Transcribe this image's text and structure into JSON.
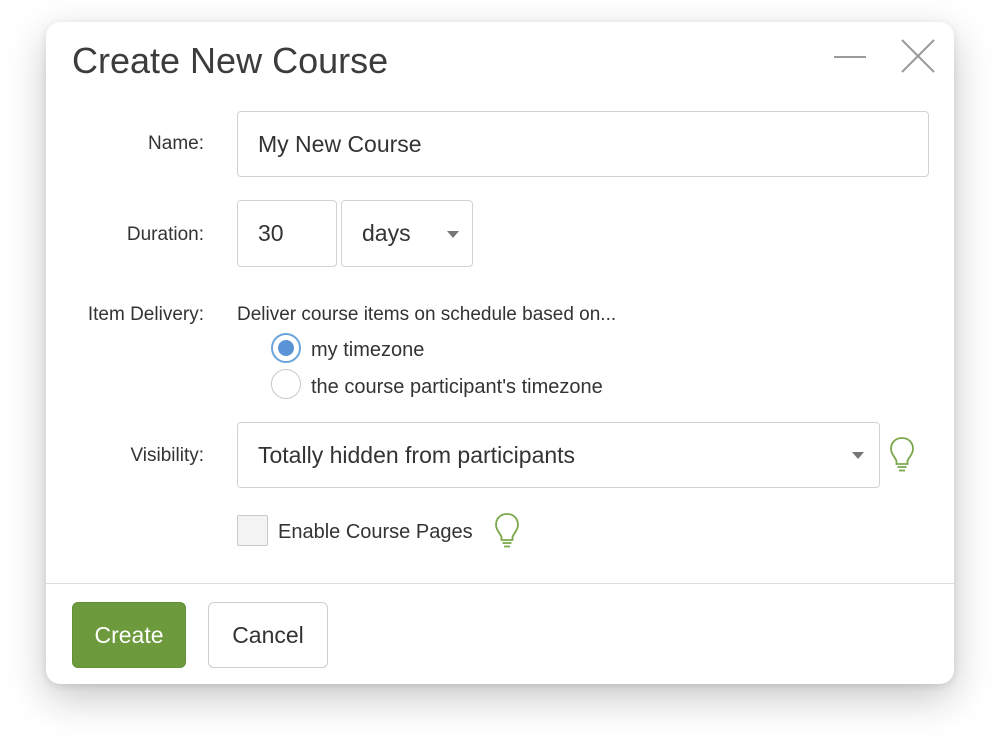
{
  "dialog": {
    "title": "Create New Course",
    "minimize_icon": "minimize-icon",
    "close_icon": "close-icon"
  },
  "form": {
    "name": {
      "label": "Name:",
      "value": "My New Course"
    },
    "duration": {
      "label": "Duration:",
      "value": "30",
      "unit": "days"
    },
    "item_delivery": {
      "label": "Item Delivery:",
      "description": "Deliver course items on schedule based on...",
      "options": [
        {
          "label": "my timezone",
          "selected": true
        },
        {
          "label": "the course participant's timezone",
          "selected": false
        }
      ]
    },
    "visibility": {
      "label": "Visibility:",
      "value": "Totally hidden from participants"
    },
    "course_pages": {
      "label": "Enable Course Pages",
      "checked": false
    }
  },
  "footer": {
    "create_label": "Create",
    "cancel_label": "Cancel"
  },
  "colors": {
    "accent_green": "#6c9a3d",
    "radio_blue": "#5b94d6",
    "bulb_green": "#7aa74a"
  }
}
